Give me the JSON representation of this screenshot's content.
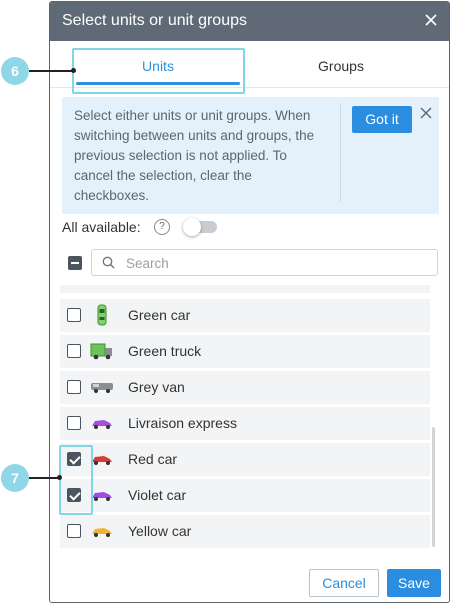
{
  "dialog": {
    "title": "Select units or unit groups",
    "tabs": [
      {
        "label": "Units"
      },
      {
        "label": "Groups"
      }
    ],
    "notice": {
      "text": "Select either units or unit groups. When switching between units and groups, the previous selection is not applied. To cancel the selection, clear the checkboxes.",
      "button": "Got it"
    },
    "all_available_label": "All available:",
    "help_glyph": "?",
    "search": {
      "placeholder": "Search",
      "value": ""
    },
    "units": [
      {
        "label": "Green car",
        "checked": false,
        "icon": "green-car-icon",
        "color": "#7fd36a"
      },
      {
        "label": "Green truck",
        "checked": false,
        "icon": "green-truck-icon",
        "color": "#5fb84a"
      },
      {
        "label": "Grey van",
        "checked": false,
        "icon": "grey-van-icon",
        "color": "#8a8e92"
      },
      {
        "label": "Livraison express",
        "checked": false,
        "icon": "purple-car-icon",
        "color": "#a64fd8"
      },
      {
        "label": "Red car",
        "checked": true,
        "icon": "red-car-icon",
        "color": "#d63a3a"
      },
      {
        "label": "Violet car",
        "checked": true,
        "icon": "violet-car-icon",
        "color": "#9b4fe0"
      },
      {
        "label": "Yellow car",
        "checked": false,
        "icon": "yellow-car-icon",
        "color": "#f0b33a"
      }
    ],
    "buttons": {
      "cancel": "Cancel",
      "save": "Save"
    }
  },
  "callouts": [
    {
      "label": "6"
    },
    {
      "label": "7"
    }
  ],
  "colors": {
    "accent": "#2b8de0",
    "header": "#606a76",
    "callout": "#8fd6e6"
  }
}
